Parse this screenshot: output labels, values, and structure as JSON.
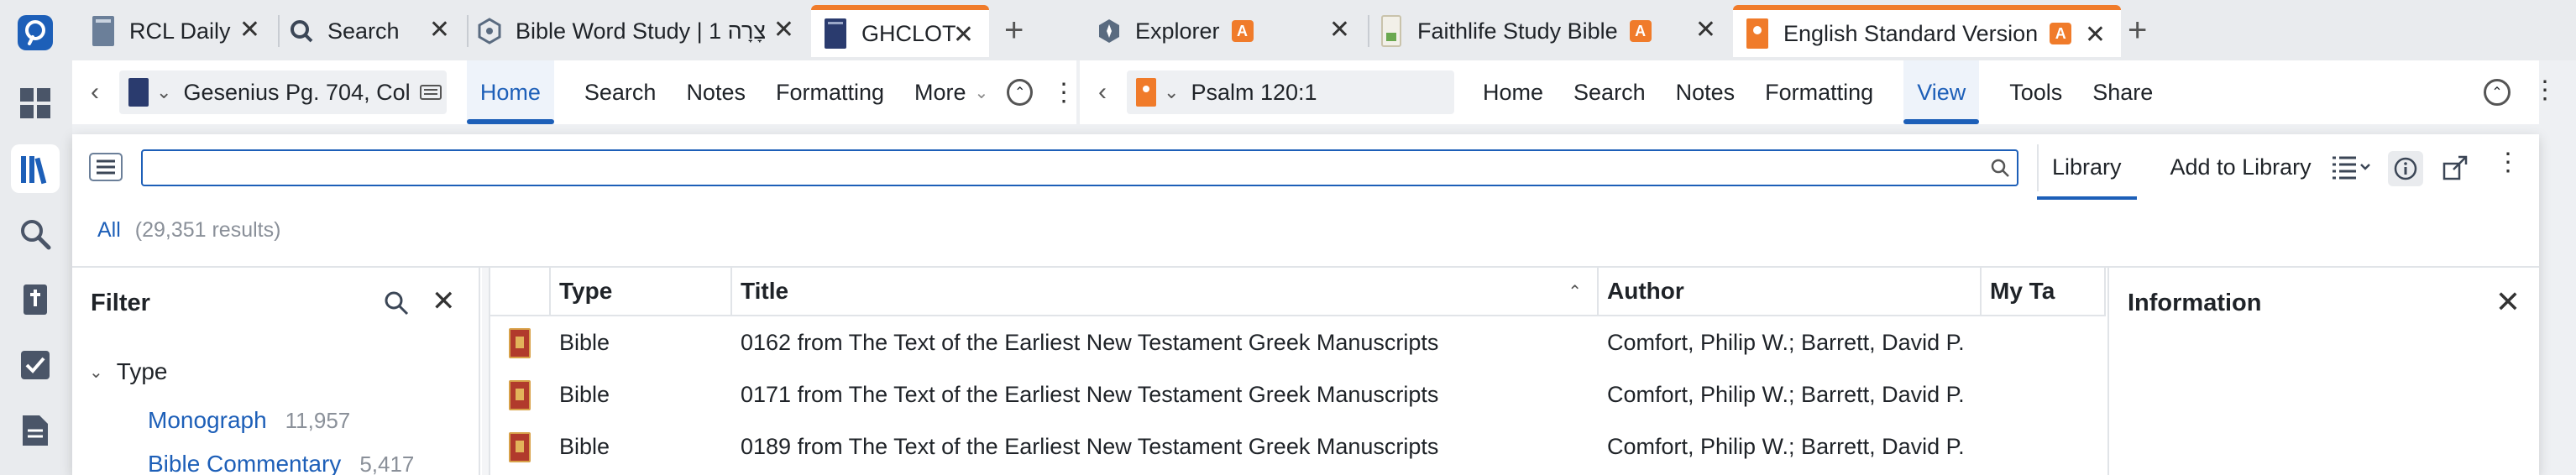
{
  "tabs": [
    {
      "label": "RCL Daily",
      "icon": "book-icon"
    },
    {
      "label": "Search",
      "icon": "search-icon"
    },
    {
      "label": "Bible Word Study | צָרָה 1",
      "icon": "word-study-icon"
    },
    {
      "label": "GHCLOT",
      "icon": "book-icon"
    },
    {
      "label": "Explorer",
      "icon": "explorer-icon",
      "badge": "A"
    },
    {
      "label": "Faithlife Study Bible",
      "icon": "bible-icon",
      "badge": "A"
    },
    {
      "label": "English Standard Version",
      "icon": "bible-icon",
      "badge": "A"
    }
  ],
  "left_panel": {
    "resource": "Gesenius Pg. 704, Col.",
    "menu": [
      "Home",
      "Search",
      "Notes",
      "Formatting",
      "More"
    ]
  },
  "right_panel": {
    "reference": "Psalm 120:1",
    "menu": [
      "Home",
      "Search",
      "Notes",
      "Formatting",
      "View",
      "Tools",
      "Share"
    ]
  },
  "library": {
    "search_placeholder": "",
    "tabs": [
      "Library",
      "Add to Library"
    ],
    "results_all": "All",
    "results_count": "(29,351 results)",
    "filter": {
      "title": "Filter",
      "type_label": "Type",
      "items": [
        {
          "label": "Monograph",
          "count": "11,957"
        },
        {
          "label": "Bible Commentary",
          "count": "5,417"
        }
      ]
    },
    "columns": [
      "Type",
      "Title",
      "Author",
      "My Ta"
    ],
    "rows": [
      {
        "type": "Bible",
        "title": "0162 from The Text of the Earliest New Testament Greek Manuscripts",
        "author": "Comfort, Philip W.; Barrett, David P."
      },
      {
        "type": "Bible",
        "title": "0171 from The Text of the Earliest New Testament Greek Manuscripts",
        "author": "Comfort, Philip W.; Barrett, David P."
      },
      {
        "type": "Bible",
        "title": "0189 from The Text of the Earliest New Testament Greek Manuscripts",
        "author": "Comfort, Philip W.; Barrett, David P."
      }
    ],
    "info_title": "Information"
  },
  "colors": {
    "accent": "#1d5fb8",
    "brand_orange": "#f07b2a",
    "book_red": "#b13a2c"
  }
}
